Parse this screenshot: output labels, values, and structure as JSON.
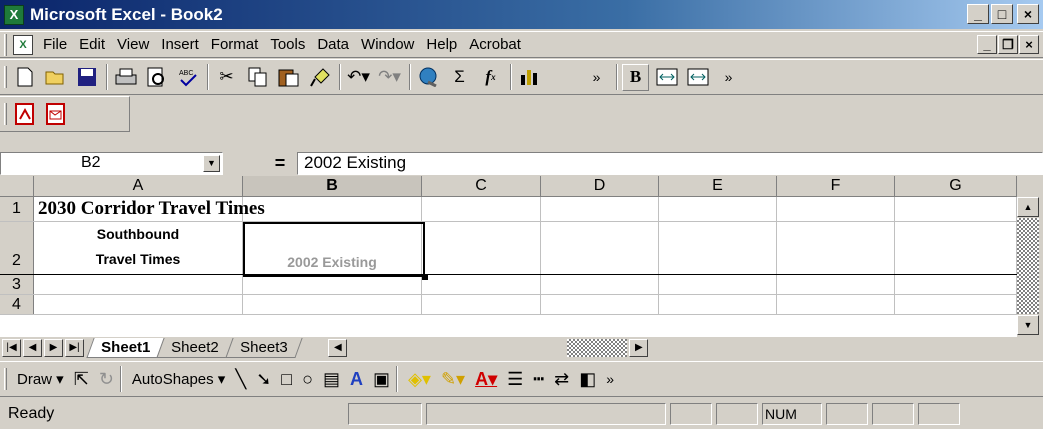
{
  "window": {
    "title": "Microsoft Excel - Book2",
    "minimize": "_",
    "maximize": "□",
    "close": "×"
  },
  "menu": {
    "items": [
      "File",
      "Edit",
      "View",
      "Insert",
      "Format",
      "Tools",
      "Data",
      "Window",
      "Help",
      "Acrobat"
    ]
  },
  "toolbar": {
    "bold_label": "B",
    "icons": [
      "new-icon",
      "open-icon",
      "save-icon",
      "print-icon",
      "print-preview-icon",
      "spelling-icon",
      "cut-icon",
      "copy-icon",
      "paste-icon",
      "format-painter-icon",
      "undo-icon",
      "redo-icon",
      "hyperlink-icon",
      "autosum-icon",
      "function-icon",
      "chart-wizard-icon",
      "more-icon",
      "bold-icon",
      "merge-center-icon",
      "merge-icon"
    ],
    "sum": "Σ",
    "fx": "f",
    "chevron": "»"
  },
  "pdf_toolbar": {
    "icons": [
      "convert-to-pdf-icon",
      "convert-and-email-icon"
    ]
  },
  "formula_bar": {
    "name_box": "B2",
    "equals": "=",
    "value": "2002 Existing"
  },
  "sheet": {
    "columns": [
      "A",
      "B",
      "C",
      "D",
      "E",
      "F",
      "G"
    ],
    "active_column": "B",
    "rows": [
      "1",
      "2",
      "3",
      "4"
    ],
    "cells": {
      "A1": "2030 Corridor Travel Times",
      "A2_line1": "Southbound",
      "A2_line2": "Travel Times",
      "B2": "2002 Existing"
    },
    "selected_cell": "B2"
  },
  "tabs": {
    "sheets": [
      "Sheet1",
      "Sheet2",
      "Sheet3"
    ],
    "active": "Sheet1"
  },
  "draw_toolbar": {
    "draw_label": "Draw",
    "autoshapes_label": "AutoShapes"
  },
  "status": {
    "ready": "Ready",
    "num": "NUM"
  }
}
